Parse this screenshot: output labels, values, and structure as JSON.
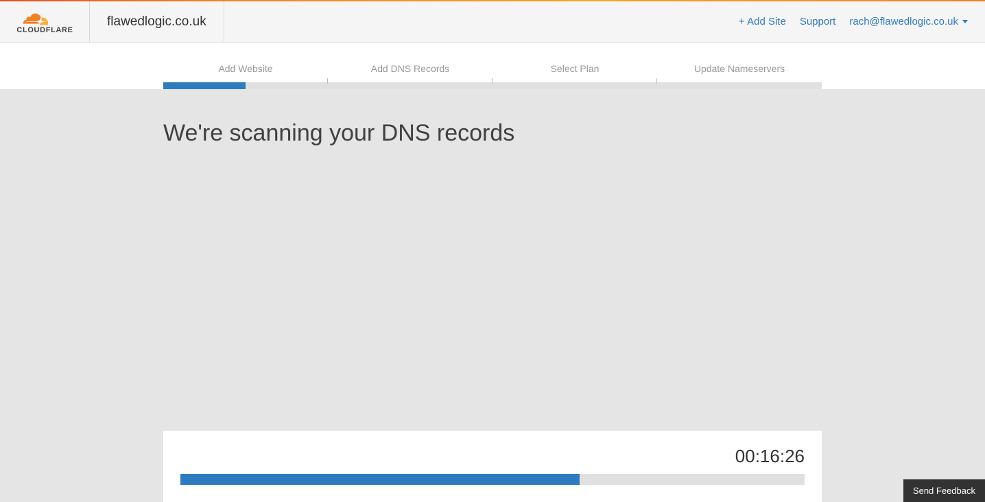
{
  "header": {
    "domain": "flawedlogic.co.uk",
    "add_site": "+ Add Site",
    "support": "Support",
    "user_email": "rach@flawedlogic.co.uk"
  },
  "steps": {
    "items": [
      {
        "label": "Add Website"
      },
      {
        "label": "Add DNS Records"
      },
      {
        "label": "Select Plan"
      },
      {
        "label": "Update Nameservers"
      }
    ],
    "progress_percent": 12.5
  },
  "main": {
    "heading": "We're scanning your DNS records"
  },
  "scan": {
    "timer": "00:16:26",
    "progress_percent": 64
  },
  "feedback": {
    "button_label": "Send Feedback"
  }
}
